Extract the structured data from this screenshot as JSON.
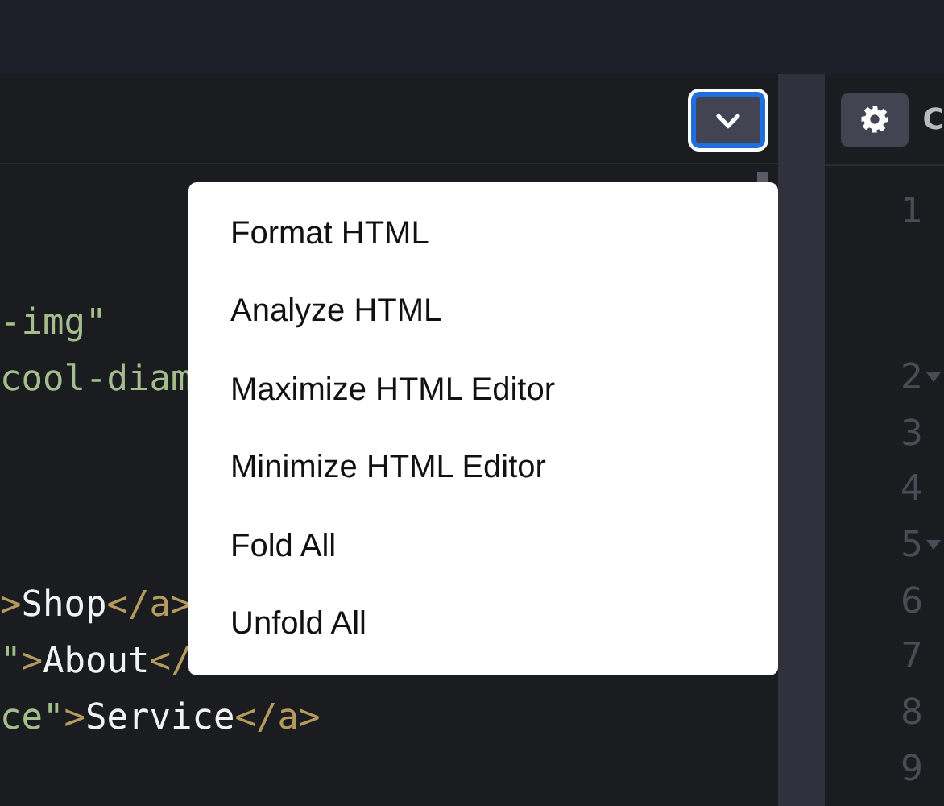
{
  "html_panel": {
    "code_groups": [
      [
        {
          "segments": [
            {
              "kind": "string",
              "text": "-img\""
            }
          ]
        },
        {
          "segments": [
            {
              "kind": "string",
              "text": "cool-diam"
            }
          ]
        }
      ],
      [
        {
          "segments": [
            {
              "kind": "tag",
              "text": ">"
            },
            {
              "kind": "text",
              "text": "Shop"
            },
            {
              "kind": "tag",
              "text": "</a>"
            }
          ]
        },
        {
          "segments": [
            {
              "kind": "string",
              "text": "\""
            },
            {
              "kind": "tag",
              "text": ">"
            },
            {
              "kind": "text",
              "text": "About"
            },
            {
              "kind": "tag",
              "text": "</"
            }
          ]
        },
        {
          "segments": [
            {
              "kind": "string",
              "text": "ce\""
            },
            {
              "kind": "tag",
              "text": ">"
            },
            {
              "kind": "text",
              "text": "Service"
            },
            {
              "kind": "tag",
              "text": "</a>"
            }
          ]
        }
      ]
    ]
  },
  "menu": {
    "items": [
      {
        "label": "Format HTML"
      },
      {
        "label": "Analyze HTML"
      },
      {
        "label": "Maximize HTML Editor"
      },
      {
        "label": "Minimize HTML Editor"
      },
      {
        "label": "Fold All"
      },
      {
        "label": "Unfold All"
      }
    ]
  },
  "css_panel": {
    "title": "C",
    "line_numbers": [
      {
        "number": "1",
        "foldable": false
      },
      {
        "number": "2",
        "foldable": true
      },
      {
        "number": "3",
        "foldable": false
      },
      {
        "number": "4",
        "foldable": false
      },
      {
        "number": "5",
        "foldable": true
      },
      {
        "number": "6",
        "foldable": false
      },
      {
        "number": "7",
        "foldable": false
      },
      {
        "number": "8",
        "foldable": false
      },
      {
        "number": "9",
        "foldable": false
      }
    ]
  }
}
